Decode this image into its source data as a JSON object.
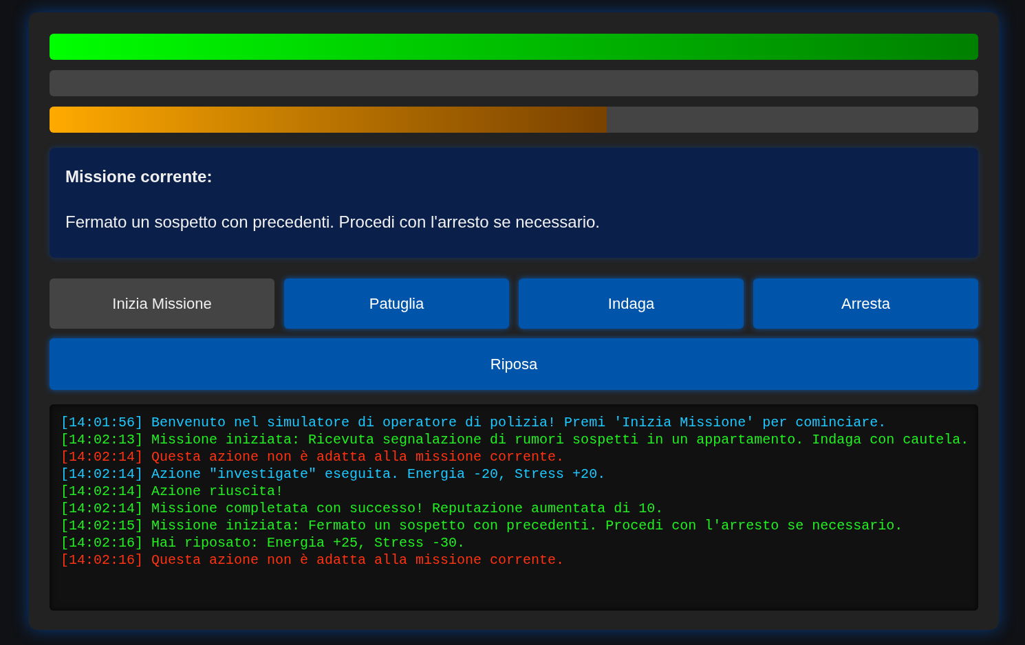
{
  "bars": [
    {
      "kind": "green",
      "level": 1
    },
    {
      "kind": "green",
      "level": 0
    },
    {
      "kind": "orange",
      "level": 0.6
    }
  ],
  "mission": {
    "heading": "Missione corrente:",
    "text": "Fermato un sospetto con precedenti. Procedi con l'arresto se necessario."
  },
  "buttons": [
    {
      "label": "Inizia Missione",
      "disabled": true
    },
    {
      "label": "Patuglia",
      "disabled": false
    },
    {
      "label": "Indaga",
      "disabled": false
    },
    {
      "label": "Arresta",
      "disabled": false
    }
  ],
  "rest_button": {
    "label": "Riposa",
    "disabled": false
  },
  "log": [
    {
      "kind": "info",
      "time": "[14:01:56]",
      "text": "Benvenuto nel simulatore di operatore di polizia! Premi 'Inizia Missione' per cominciare."
    },
    {
      "kind": "success",
      "time": "[14:02:13]",
      "text": "Missione iniziata: Ricevuta segnalazione di rumori sospetti in un appartamento. Indaga con cautela."
    },
    {
      "kind": "error",
      "time": "[14:02:14]",
      "text": "Questa azione non è adatta alla missione corrente."
    },
    {
      "kind": "info",
      "time": "[14:02:14]",
      "text": "Azione \"investigate\" eseguita. Energia -20, Stress +20."
    },
    {
      "kind": "success",
      "time": "[14:02:14]",
      "text": "Azione riuscita!"
    },
    {
      "kind": "success",
      "time": "[14:02:14]",
      "text": "Missione completata con successo! Reputazione aumentata di 10."
    },
    {
      "kind": "success",
      "time": "[14:02:15]",
      "text": "Missione iniziata: Fermato un sospetto con precedenti. Procedi con l'arresto se necessario."
    },
    {
      "kind": "success",
      "time": "[14:02:16]",
      "text": "Hai riposato: Energia +25, Stress -30."
    },
    {
      "kind": "error",
      "time": "[14:02:16]",
      "text": "Questa azione non è adatta alla missione corrente."
    }
  ]
}
